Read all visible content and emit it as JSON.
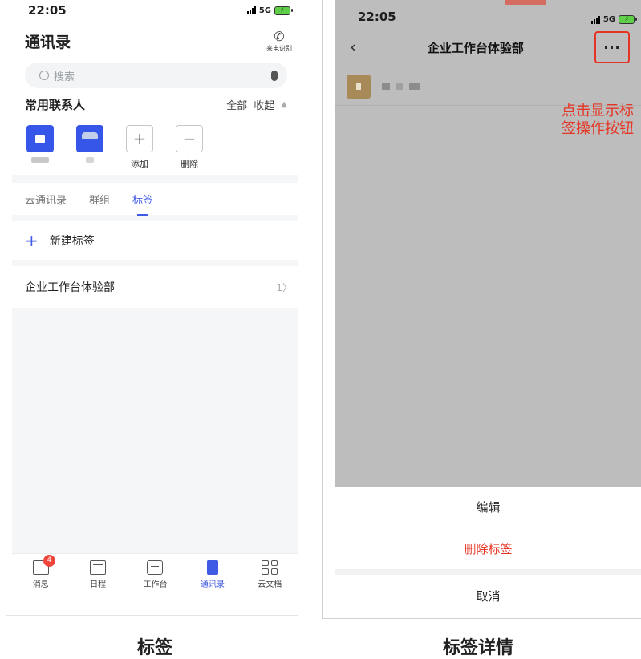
{
  "left": {
    "status": {
      "time": "22:05",
      "network": "5G"
    },
    "header": {
      "title": "通讯录",
      "caller_id": "来电识别"
    },
    "search": {
      "placeholder": "搜索"
    },
    "favorites": {
      "title": "常用联系人",
      "all": "全部",
      "collapse": "收起",
      "add": "添加",
      "delete": "删除"
    },
    "tabs": [
      {
        "label": "云通讯录"
      },
      {
        "label": "群组"
      },
      {
        "label": "标签"
      }
    ],
    "new_tag": "新建标签",
    "tag_row": {
      "name": "企业工作台体验部",
      "count": "1"
    },
    "tabbar": {
      "items": [
        {
          "label": "消息",
          "icon": "message-icon"
        },
        {
          "label": "日程",
          "icon": "calendar-icon"
        },
        {
          "label": "工作台",
          "icon": "briefcase-icon"
        },
        {
          "label": "通讯录",
          "icon": "contacts-icon"
        },
        {
          "label": "云文档",
          "icon": "grid-icon"
        }
      ],
      "badge": "4"
    }
  },
  "right": {
    "status": {
      "time": "22:05",
      "network": "5G"
    },
    "header": {
      "title": "企业工作台体验部",
      "more": "···"
    },
    "annotation": "点击显示标签操作按钮",
    "sheet": {
      "edit": "编辑",
      "delete": "删除标签",
      "cancel": "取消"
    }
  },
  "captions": {
    "left": "标签",
    "right": "标签详情"
  },
  "colors": {
    "accent": "#3f5ae5",
    "danger": "#e53524",
    "overlay": "#bdbdbd"
  }
}
